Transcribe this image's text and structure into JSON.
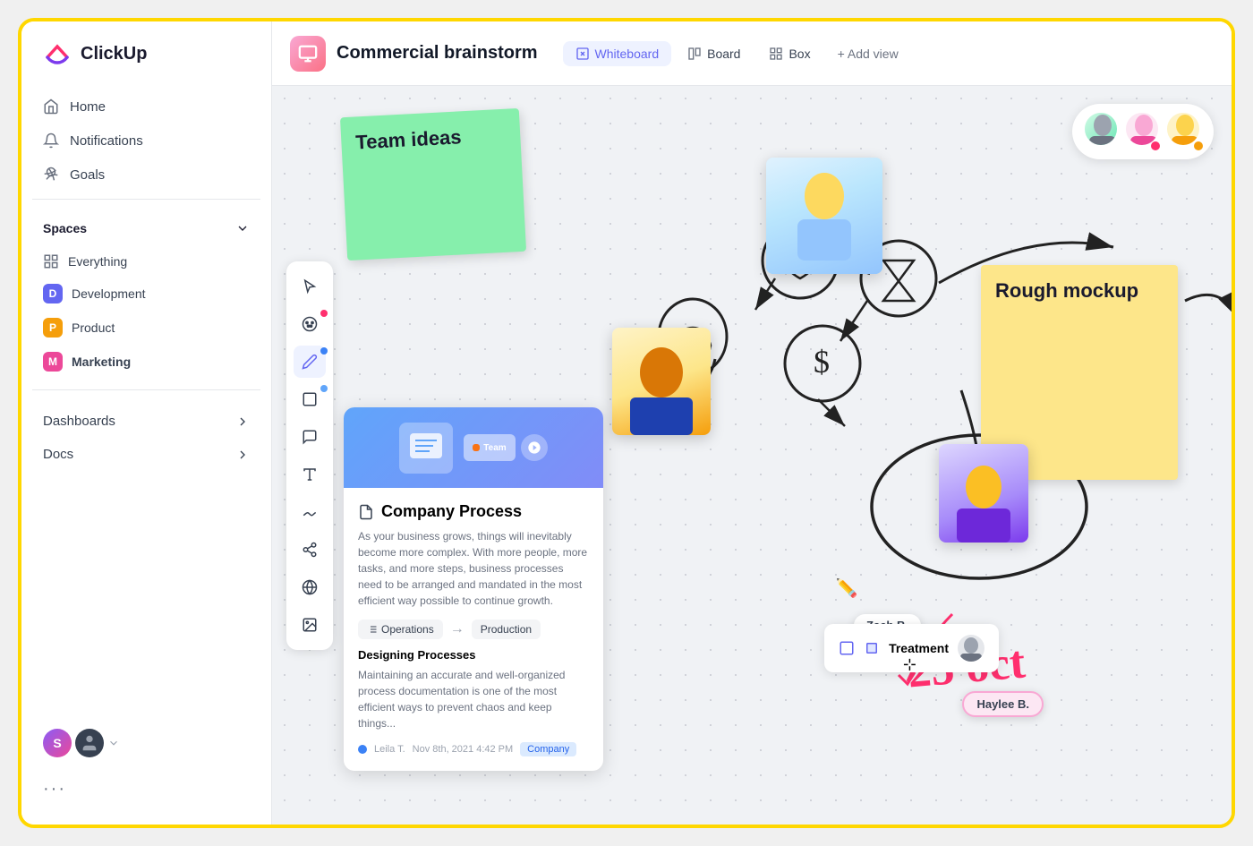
{
  "app": {
    "name": "ClickUp"
  },
  "sidebar": {
    "nav": [
      {
        "label": "Home",
        "icon": "home"
      },
      {
        "label": "Notifications",
        "icon": "bell"
      },
      {
        "label": "Goals",
        "icon": "trophy"
      }
    ],
    "spaces_label": "Spaces",
    "spaces": [
      {
        "label": "Everything",
        "type": "all"
      },
      {
        "label": "Development",
        "color": "#6366F1",
        "initial": "D"
      },
      {
        "label": "Product",
        "color": "#F59E0B",
        "initial": "P"
      },
      {
        "label": "Marketing",
        "color": "#EC4899",
        "initial": "M",
        "bold": true
      }
    ],
    "dashboards_label": "Dashboards",
    "docs_label": "Docs"
  },
  "header": {
    "page_title": "Commercial brainstorm",
    "views": [
      {
        "label": "Whiteboard",
        "active": true
      },
      {
        "label": "Board"
      },
      {
        "label": "Box"
      }
    ],
    "add_view": "+ Add view"
  },
  "whiteboard": {
    "sticky_notes": [
      {
        "text": "Team ideas",
        "color": "green"
      },
      {
        "text": "Rough mockup",
        "color": "yellow"
      }
    ],
    "doc_card": {
      "title": "Company Process",
      "description": "As your business grows, things will inevitably become more complex. With more people, more tasks, and more steps, business processes need to be arranged and mandated in the most efficient way possible to continue growth.",
      "tags": [
        "Operations",
        "Production"
      ],
      "section": "Designing Processes",
      "section_desc": "Maintaining an accurate and well-organized process documentation is one of the most efficient ways to prevent chaos and keep things...",
      "author": "Leila T.",
      "date": "Nov 8th, 2021 4:42 PM",
      "badge": "Company"
    },
    "user_badges": [
      {
        "name": "Zach B.",
        "color": "#fff"
      },
      {
        "name": "Haylee B.",
        "color": "#fce7f3"
      }
    ],
    "task_card": {
      "label": "Treatment",
      "icon": "■"
    },
    "handwriting": "25 oct",
    "tools": [
      "cursor",
      "palette",
      "pencil",
      "square",
      "note",
      "text",
      "signature",
      "share",
      "globe",
      "image",
      "more"
    ]
  },
  "collaborators": [
    {
      "bg": "#d1d5db"
    },
    {
      "bg": "#f9a8d4"
    },
    {
      "bg": "#fde68a"
    }
  ],
  "footer": {
    "avatar1": "S",
    "avatar2": "👤"
  }
}
